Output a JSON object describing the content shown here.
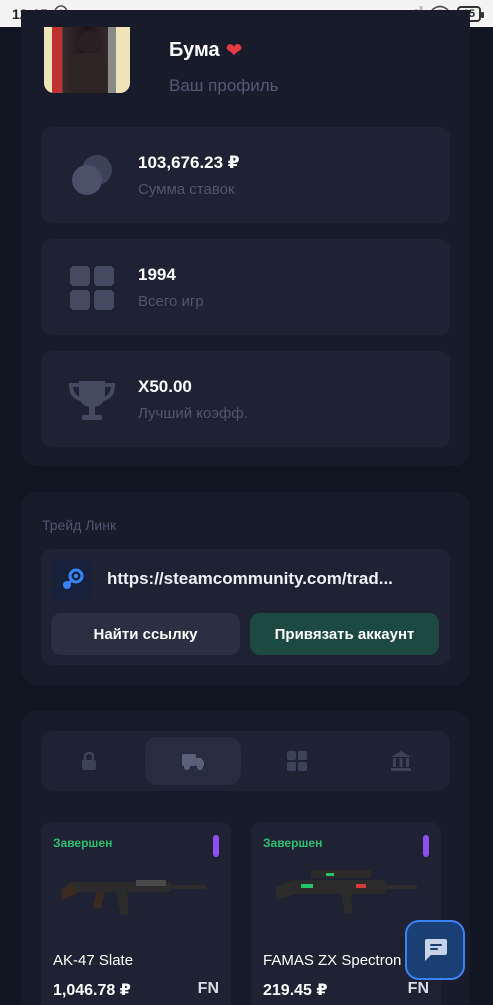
{
  "status_bar": {
    "time": "12:15",
    "battery": "65"
  },
  "profile": {
    "name": "Бума",
    "subtitle": "Ваш профиль",
    "stats": [
      {
        "value": "103,676.23 ₽",
        "label": "Сумма ставок",
        "icon": "coins-icon"
      },
      {
        "value": "1994",
        "label": "Всего игр",
        "icon": "grid-icon"
      },
      {
        "value": "X50.00",
        "label": "Лучший коэфф.",
        "icon": "trophy-icon"
      }
    ]
  },
  "trade": {
    "label": "Трейд Линк",
    "link": "https://steamcommunity.com/trad...",
    "find_button": "Найти ссылку",
    "bind_button": "Привязать аккаунт"
  },
  "inventory": {
    "tabs": [
      {
        "name": "lock-icon",
        "active": false
      },
      {
        "name": "truck-icon",
        "active": true
      },
      {
        "name": "grid-icon",
        "active": false
      },
      {
        "name": "bank-icon",
        "active": false
      }
    ],
    "items": [
      {
        "status": "Завершен",
        "name": "AK-47 Slate",
        "price": "1,046.78 ₽",
        "wear": "FN",
        "rarity_color": "#8f4ff0"
      },
      {
        "status": "Завершен",
        "name": "FAMAS ZX Spectron",
        "price": "219.45 ₽",
        "wear": "FN",
        "rarity_color": "#8f4ff0"
      }
    ]
  },
  "colors": {
    "background": "#121522",
    "card": "#181c2a",
    "accent_green": "#2bbf72",
    "primary_blue": "#3b82f6"
  }
}
